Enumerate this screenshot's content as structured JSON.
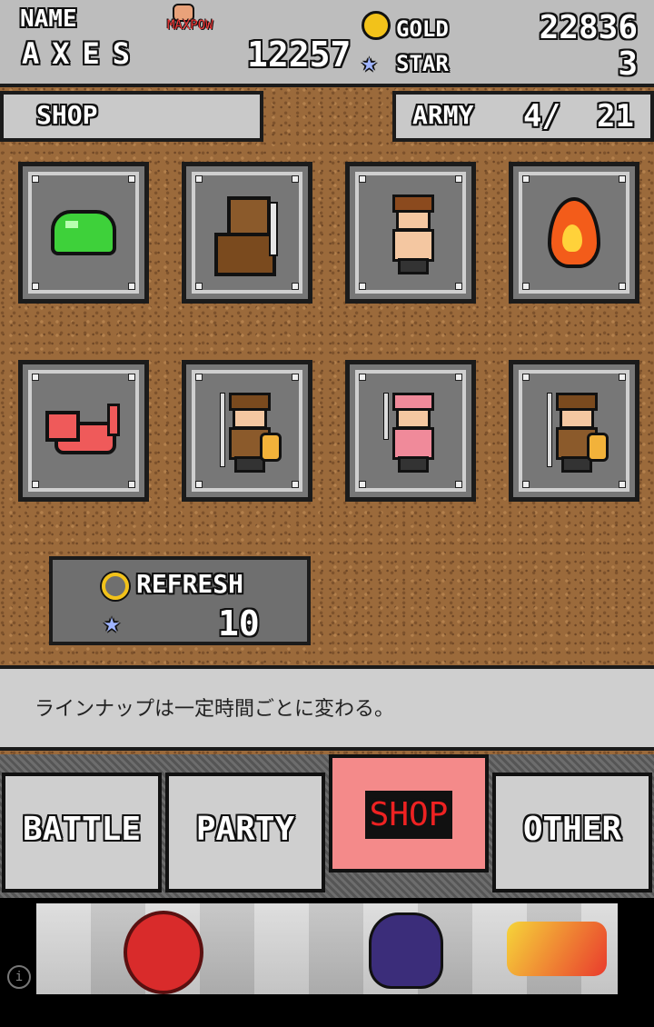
{
  "header": {
    "name_label": "NAME",
    "player_name": "AXES",
    "maxpow_label": "MAXPOW",
    "maxpow_value": "12257",
    "gold_label": "GOLD",
    "gold_value": "22836",
    "star_label": "STAR",
    "star_value": "3"
  },
  "shop": {
    "title": "SHOP",
    "army_label": "ARMY",
    "army_count": "4/",
    "army_max": "21",
    "items": [
      {
        "name": "green-slime",
        "icon": "slime-icon"
      },
      {
        "name": "wolf-warrior",
        "icon": "wolf-warrior-icon"
      },
      {
        "name": "brawler",
        "icon": "brawler-icon"
      },
      {
        "name": "fire-spirit",
        "icon": "flame-icon"
      },
      {
        "name": "red-cat",
        "icon": "cat-icon"
      },
      {
        "name": "spear-soldier",
        "icon": "soldier-icon"
      },
      {
        "name": "pink-fighter",
        "icon": "pink-fighter-icon"
      },
      {
        "name": "spear-soldier",
        "icon": "soldier-icon"
      }
    ],
    "refresh_label": "REFRESH",
    "refresh_cost": "10"
  },
  "message": "ラインナップは一定時間ごとに変わる。",
  "tabs": {
    "battle": "BATTLE",
    "party": "PARTY",
    "shop": "SHOP",
    "other": "OTHER",
    "active": "SHOP"
  },
  "colors": {
    "dirt": "#9b6a3b",
    "active_tab": "#f48a8a",
    "panel": "#c9c9c9"
  }
}
